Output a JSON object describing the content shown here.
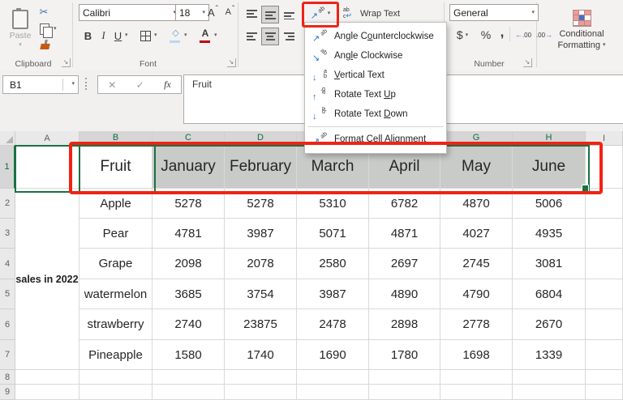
{
  "ribbon": {
    "clipboard": {
      "group_label": "Clipboard",
      "paste_label": "Paste"
    },
    "font": {
      "group_label": "Font",
      "font_name": "Calibri",
      "font_size": "18"
    },
    "alignment": {
      "wrap_text_label": "Wrap Text"
    },
    "number": {
      "group_label": "Number",
      "format_value": "General"
    },
    "styles": {
      "conditional_line1": "Conditional",
      "conditional_line2": "Formatting"
    }
  },
  "icons": {
    "caret": "▾",
    "caret_up": "ˆ",
    "caron": "ˇ",
    "dialog_launcher": "↘",
    "cut": "✂",
    "bold": "B",
    "italic": "I",
    "underline": "U",
    "letter_a": "A",
    "fill": "◇",
    "dollar": "$",
    "percent": "%",
    "comma": ",",
    "left_arrow": "←",
    "right_arrow": "→",
    "decimal_text": ".00",
    "cancel": "✕",
    "enter": "✓",
    "fx": "fx",
    "ab_glyph": "ab",
    "orientation_arrow": "↗",
    "wrap_line1": "ab",
    "wrap_line2": "c",
    "wrap_return": "↵"
  },
  "formula_bar": {
    "name_box": "B1",
    "value": "Fruit"
  },
  "menu": {
    "items": [
      {
        "label": "Angle Counterclockwise",
        "accel_index": 7,
        "icon": "angle-counterclockwise-icon"
      },
      {
        "label": "Angle Clockwise",
        "accel_index": 3,
        "icon": "angle-clockwise-icon"
      },
      {
        "label": "Vertical Text",
        "accel_index": 0,
        "icon": "vertical-text-icon"
      },
      {
        "label": "Rotate Text Up",
        "accel_index": 12,
        "icon": "rotate-text-up-icon"
      },
      {
        "label": "Rotate Text Down",
        "accel_index": 12,
        "icon": "rotate-text-down-icon"
      },
      {
        "label": "Format Cell Alignment",
        "accel_index": 3,
        "icon": "format-cell-alignment-icon",
        "separator_before": true
      }
    ]
  },
  "spreadsheet": {
    "col_letters": [
      "",
      "A",
      "B",
      "C",
      "D",
      "E",
      "F",
      "G",
      "H",
      "I"
    ],
    "selected_columns": [
      "B",
      "C",
      "D",
      "E",
      "F",
      "G",
      "H"
    ],
    "selected_row": 1,
    "merged_label": "sales in 2022",
    "rows": [
      {
        "n": 1,
        "cells": [
          "",
          "Fruit",
          "January",
          "February",
          "March",
          "April",
          "May",
          "June",
          ""
        ]
      },
      {
        "n": 2,
        "cells": [
          "",
          "Apple",
          "5278",
          "5278",
          "5310",
          "6782",
          "4870",
          "5006",
          ""
        ]
      },
      {
        "n": 3,
        "cells": [
          "",
          "Pear",
          "4781",
          "3987",
          "5071",
          "4871",
          "4027",
          "4935",
          ""
        ]
      },
      {
        "n": 4,
        "cells": [
          "",
          "Grape",
          "2098",
          "2078",
          "2580",
          "2697",
          "2745",
          "3081",
          ""
        ]
      },
      {
        "n": 5,
        "cells": [
          "",
          "watermelon",
          "3685",
          "3754",
          "3987",
          "4890",
          "4790",
          "6804",
          ""
        ]
      },
      {
        "n": 6,
        "cells": [
          "",
          "strawberry",
          "2740",
          "23875",
          "2478",
          "2898",
          "2778",
          "2670",
          ""
        ]
      },
      {
        "n": 7,
        "cells": [
          "",
          "Pineapple",
          "1580",
          "1740",
          "1690",
          "1780",
          "1698",
          "1339",
          ""
        ]
      },
      {
        "n": 8,
        "cells": [
          "",
          "",
          "",
          "",
          "",
          "",
          "",
          "",
          ""
        ]
      },
      {
        "n": 9,
        "cells": [
          "",
          "",
          "",
          "",
          "",
          "",
          "",
          "",
          ""
        ]
      }
    ]
  },
  "annotations": {
    "highlight_color": "#f02314"
  }
}
